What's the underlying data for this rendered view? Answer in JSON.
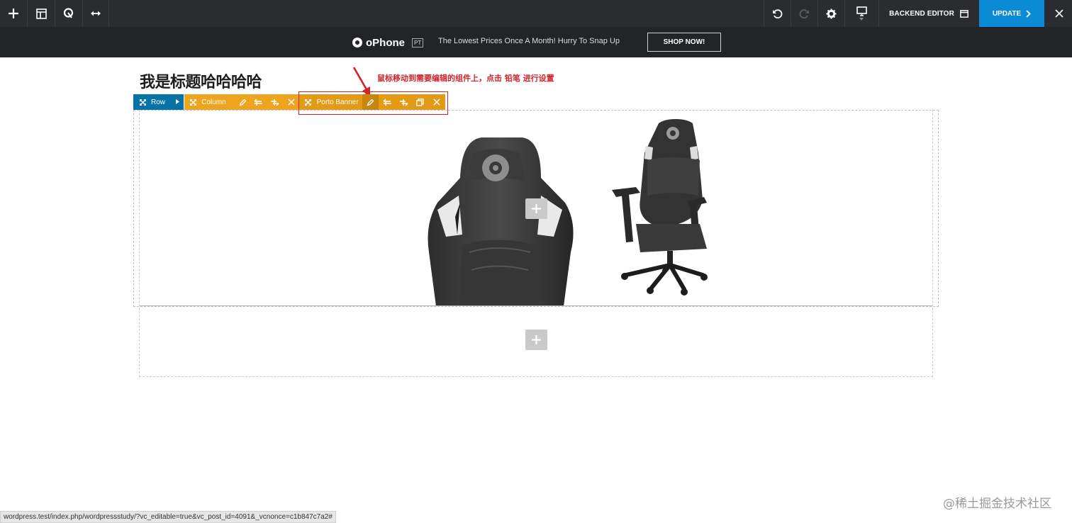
{
  "toolbar": {
    "add_icon": "plus-icon",
    "templates_icon": "layout-icon",
    "seo_icon": "seo-icon",
    "width_icon": "resize-icon",
    "undo_icon": "undo-icon",
    "redo_icon": "redo-icon",
    "settings_icon": "gear-icon",
    "device_icon": "monitor-icon",
    "backend_editor_label": "BACKEND EDITOR",
    "update_label": "UPDATE",
    "close_icon": "close-icon",
    "update_color": "#0b8ad6"
  },
  "promo": {
    "logo_text": "oPhone",
    "logo_badge": "PT",
    "message": "The Lowest Prices Once A Month! Hurry To Snap Up",
    "button_label": "SHOP NOW!"
  },
  "page": {
    "title": "我是标题哈哈哈哈",
    "annotation": "鼠标移动到需要编辑的组件上，点击 铅笔 进行设置",
    "annotation_color": "#d2232a"
  },
  "controls": {
    "row_label": "Row",
    "column_label": "Column",
    "banner_label": "Porto Banner",
    "row_color": "#0573a6",
    "column_color": "#efa420"
  },
  "status_bar": {
    "url": "wordpress.test/index.php/wordpressstudy/?vc_editable=true&vc_post_id=4091&_vcnonce=c1b847c7a2#"
  },
  "watermark": "@稀土掘金技术社区"
}
